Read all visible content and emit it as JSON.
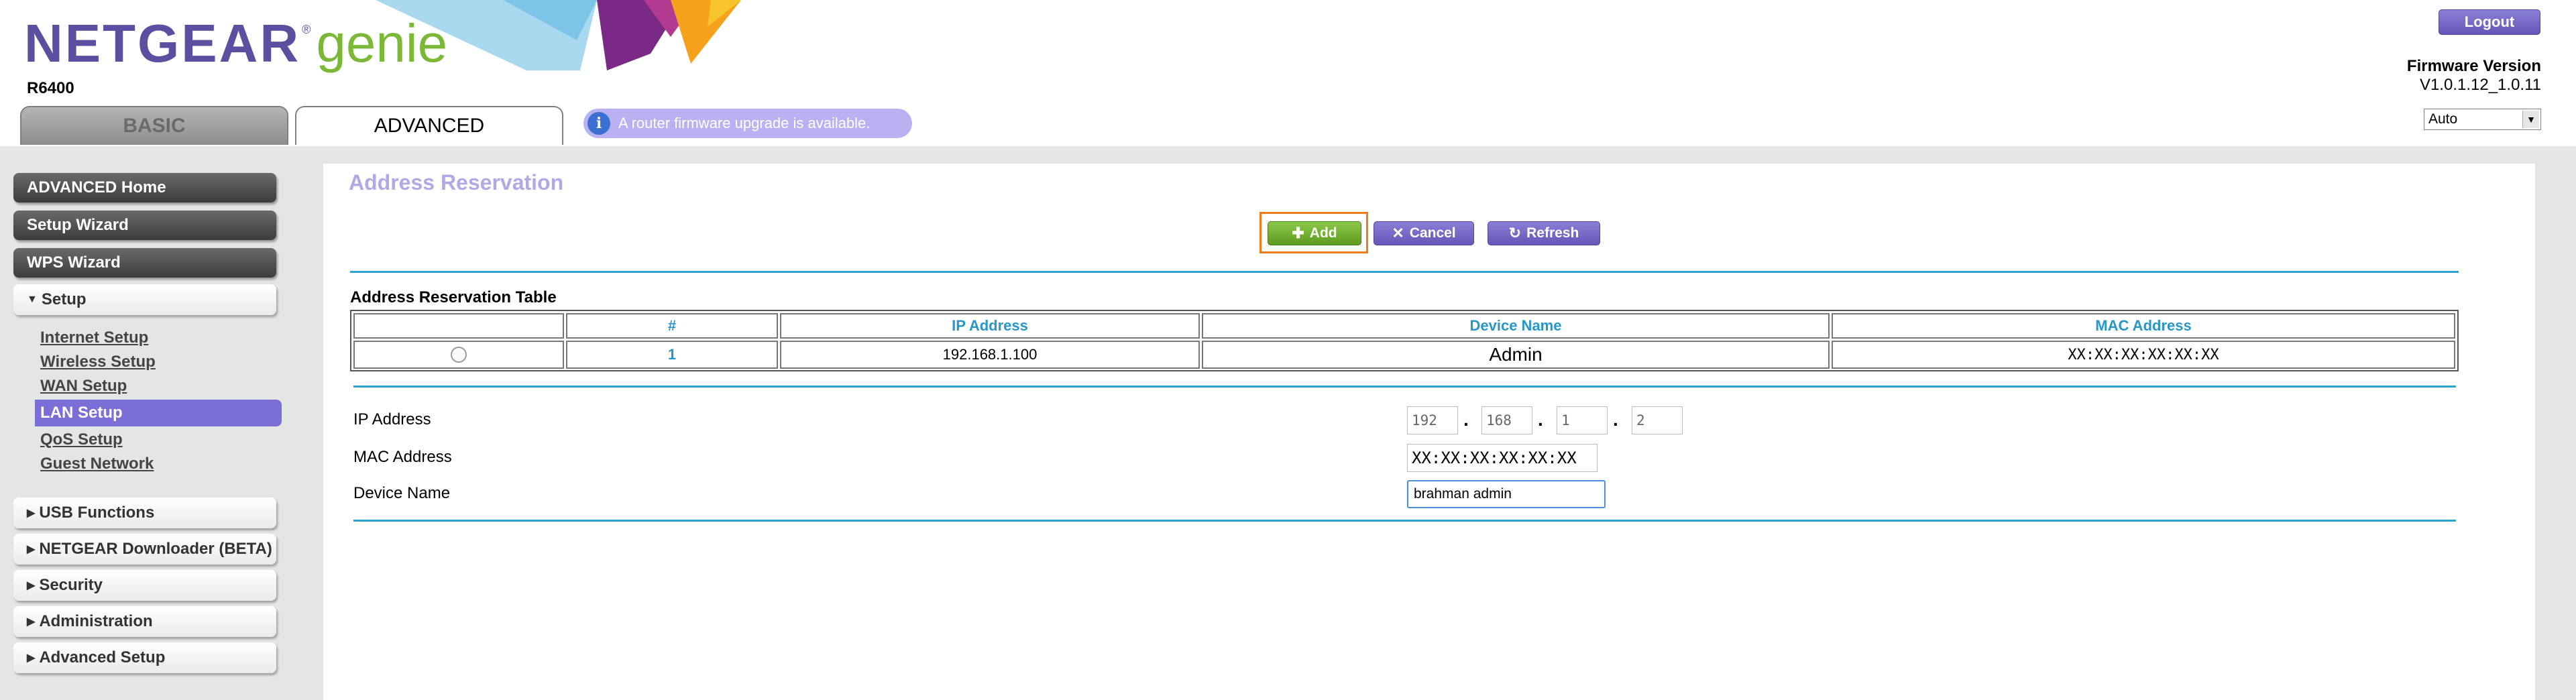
{
  "header": {
    "brand": "NETGEAR",
    "brand_reg": "®",
    "product": "genie",
    "model": "R6400",
    "logout_label": "Logout",
    "firmware_label": "Firmware Version",
    "firmware_value": "V1.0.1.12_1.0.11",
    "language_selected": "Auto",
    "firmware_notice": "A router firmware upgrade is available.",
    "info_glyph": "i"
  },
  "tabs": [
    {
      "label": "BASIC",
      "active": false
    },
    {
      "label": "ADVANCED",
      "active": true
    }
  ],
  "sidebar": {
    "advanced_home": "ADVANCED Home",
    "setup_wizard": "Setup Wizard",
    "wps_wizard": "WPS Wizard",
    "setup": "Setup",
    "setup_items": [
      "Internet Setup",
      "Wireless Setup",
      "WAN Setup",
      "LAN Setup",
      "QoS Setup",
      "Guest Network"
    ],
    "active_item": "LAN Setup",
    "usb_functions": "USB Functions",
    "downloader": "NETGEAR Downloader (BETA)",
    "security": "Security",
    "administration": "Administration",
    "advanced_setup": "Advanced Setup"
  },
  "main": {
    "title": "Address Reservation",
    "buttons": {
      "add": "Add",
      "cancel": "Cancel",
      "refresh": "Refresh"
    },
    "table_title": "Address Reservation Table",
    "columns": [
      "",
      "#",
      "IP Address",
      "Device Name",
      "MAC Address"
    ],
    "rows": [
      {
        "num": "1",
        "ip": "192.168.1.100",
        "name": "Admin",
        "mac": "XX:XX:XX:XX:XX:XX"
      }
    ],
    "form": {
      "ip_label": "IP Address",
      "ip_octets": [
        "192",
        "168",
        "1",
        "2"
      ],
      "ip_separator": ".",
      "mac_label": "MAC Address",
      "mac_value": "XX:XX:XX:XX:XX:XX",
      "name_label": "Device Name",
      "name_value": "brahman admin"
    }
  },
  "colors": {
    "brand_purple": "#5b4fa0",
    "genie_green": "#7ab836",
    "accent_purple": "#7b6ed6",
    "link_blue": "#2697c7",
    "highlight_orange": "#f07d1a"
  }
}
